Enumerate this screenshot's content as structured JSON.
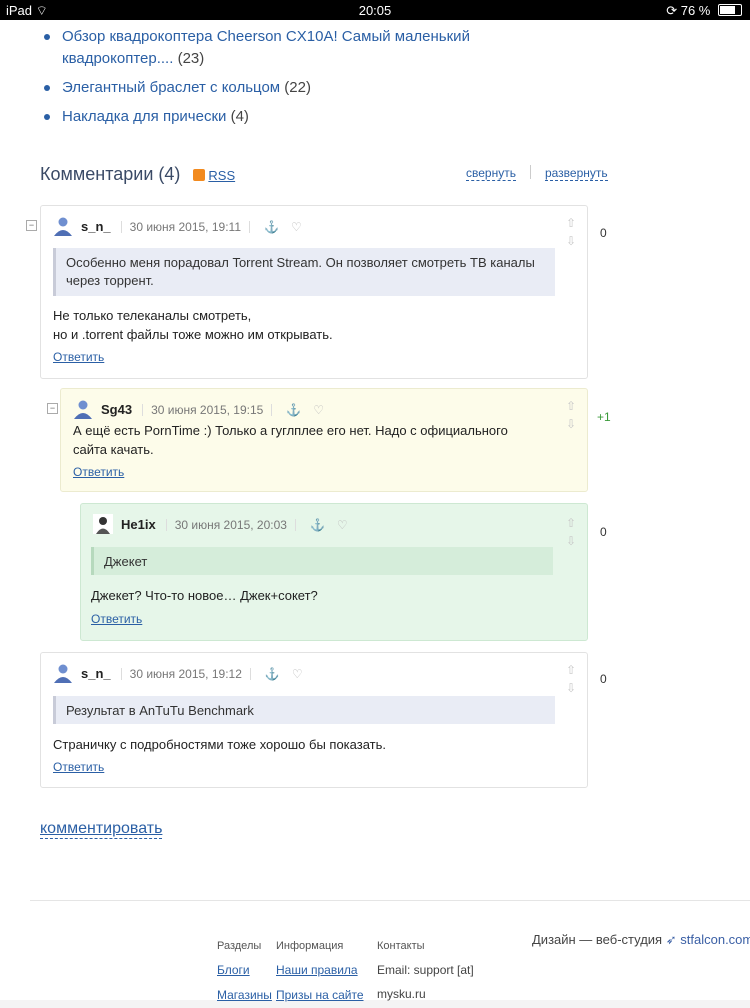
{
  "statusbar": {
    "device": "iPad",
    "time": "20:05",
    "battery": "76 %",
    "battery_level": 0.76
  },
  "related_links": [
    {
      "title": "Обзор квадрокоптера Cheerson CX10A! Самый маленький квадрокоптер....",
      "count": "(23)"
    },
    {
      "title": "Элегантный браслет с кольцом",
      "count": "(22)"
    },
    {
      "title": "Накладка для прически",
      "count": "(4)"
    }
  ],
  "comments_header": {
    "title": "Комментарии (4)",
    "rss": "RSS",
    "collapse": "свернуть",
    "expand": "развернуть"
  },
  "comments": [
    {
      "author": "s_n_",
      "date": "30 июня 2015, 19:11",
      "quote": "Особенно меня порадовал Torrent Stream. Он позволяет смотреть ТВ каналы через торрент.",
      "text_line1": "Не только телеканалы смотреть,",
      "text_line2": "но и .torrent файлы тоже можно им открывать.",
      "reply": "Ответить",
      "score": "0"
    },
    {
      "author": "Sg43",
      "date": "30 июня 2015, 19:15",
      "text": "А ещё есть PornTime :) Только а гуглплее его нет. Надо с официального сайта качать.",
      "reply": "Ответить",
      "score": "+1"
    },
    {
      "author": "He1ix",
      "date": "30 июня 2015, 20:03",
      "quote": "Джекет",
      "text": "Джекет? Что-то новое… Джек+сокет?",
      "reply": "Ответить",
      "score": "0"
    },
    {
      "author": "s_n_",
      "date": "30 июня 2015, 19:12",
      "quote": "Результат в AnTuTu Benchmark",
      "text": "Страничку с подробностями тоже хорошо бы показать.",
      "reply": "Ответить",
      "score": "0"
    }
  ],
  "add_comment": "комментировать",
  "footer": {
    "col1": {
      "heading": "Разделы",
      "links": [
        "Блоги",
        "Магазины"
      ]
    },
    "col2": {
      "heading": "Информация",
      "links": [
        "Наши правила",
        "Призы на сайте"
      ]
    },
    "col3": {
      "heading": "Контакты",
      "lines": [
        "Email: support [at]",
        "mysku.ru"
      ]
    },
    "design": {
      "label": "Дизайн — веб-студия",
      "brand": "stfalcon.com"
    }
  },
  "colors": {
    "link": "#2a5fa5",
    "green_comment": "#e6f6e9",
    "yellow_comment": "#fdfcea",
    "positive_score": "#3a9a3a"
  }
}
